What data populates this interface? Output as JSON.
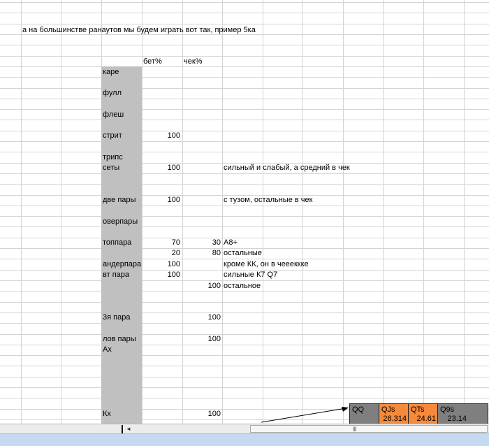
{
  "note": "а на большинстве ранаутов мы будем играть вот так, пример 5ка",
  "headers": {
    "bet": "бет%",
    "check": "чек%"
  },
  "rows": {
    "kare": "каре",
    "full": "фулл",
    "flush": "флеш",
    "straight": {
      "label": "стрит",
      "bet": "100"
    },
    "trips": "трипс",
    "sets": {
      "label": "сеты",
      "bet": "100",
      "comment": "сильный и слабый, а средний в чек"
    },
    "two_pairs": {
      "label": "две пары",
      "bet": "100",
      "comment": "с тузом, остальные в  чек"
    },
    "overpair": "оверпары",
    "top_pair": {
      "label": "топпара",
      "bet": "70",
      "check": "30",
      "comment": "A8+"
    },
    "top_pair_rest": {
      "bet": "20",
      "check": "80",
      "comment": "остальные"
    },
    "under_pair": {
      "label": "андерпара",
      "bet": "100",
      "comment": "кроме КК, он в чеееккке"
    },
    "second_pair": {
      "label": "вт пара",
      "bet": "100",
      "comment": "сильные  К7 Q7"
    },
    "second_pair_rest": {
      "check": "100",
      "comment": "остальное"
    },
    "third_pair": {
      "label": "3я пара",
      "check": "100"
    },
    "low_pairs": {
      "label": "лов пары",
      "check": "100"
    },
    "ax": "Ах",
    "kx": {
      "label": "Кх",
      "check": "100"
    }
  },
  "hand_table": [
    {
      "hand": "QQ",
      "value": "",
      "color": "#7f7f7f"
    },
    {
      "hand": "QJs",
      "value": "26.314",
      "color": "#f58a3b"
    },
    {
      "hand": "QTs",
      "value": "24.61",
      "color": "#f58a3b"
    },
    {
      "hand": "Q9s",
      "value": "23.14",
      "color": "#7f7f7f"
    }
  ],
  "scrollbar": {
    "left_arrow": "◄",
    "grip": "III"
  },
  "colors": {
    "label_column_shade": "#c0c0c0",
    "grid": "#d4d4d4",
    "status_bar": "#c5d9f1"
  }
}
